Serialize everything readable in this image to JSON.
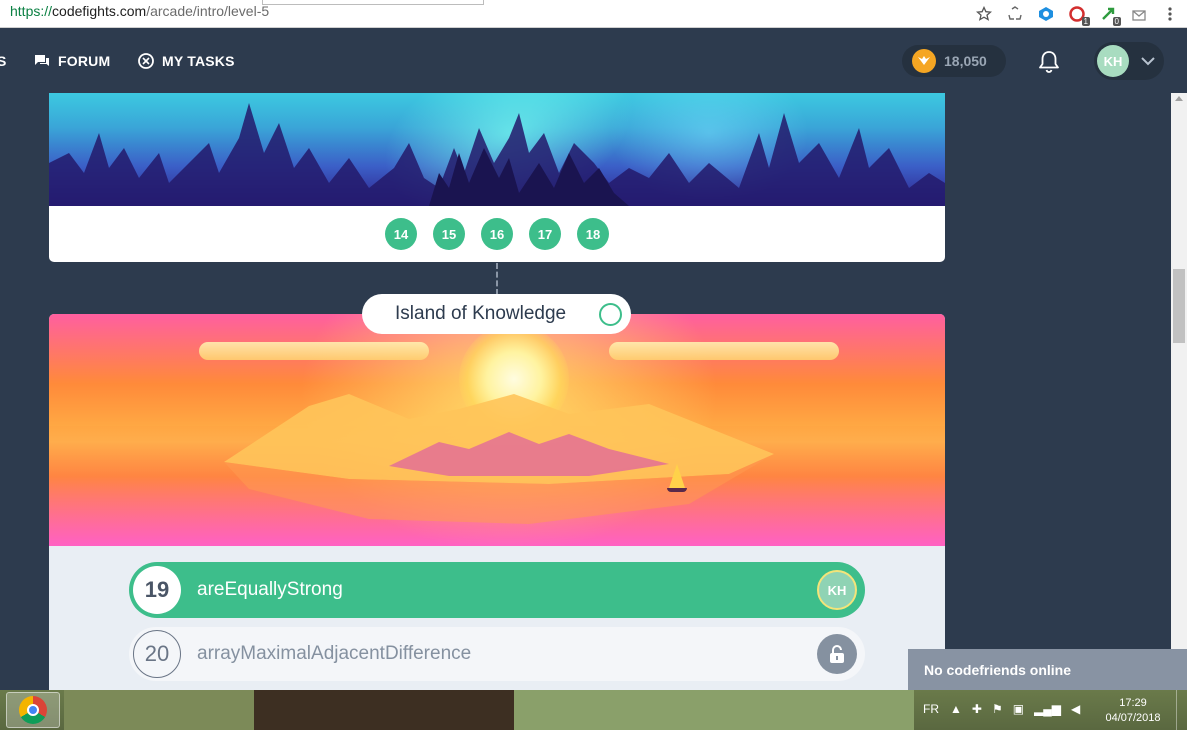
{
  "browser": {
    "url_scheme": "https://",
    "url_host": "codefights.com",
    "url_path": "/arcade/intro/level-5",
    "extension_badges": [
      "1",
      "0"
    ]
  },
  "header": {
    "nav_partial": "S",
    "forum_label": "FORUM",
    "tasks_label": "MY TASKS",
    "coins": "18,050",
    "avatar_initials": "KH"
  },
  "ocean_level": {
    "levels": [
      "14",
      "15",
      "16",
      "17",
      "18"
    ]
  },
  "island": {
    "title": "Island of Knowledge"
  },
  "tasks": [
    {
      "number": "19",
      "name": "areEquallyStrong",
      "avatar": "KH"
    },
    {
      "number": "20",
      "name": "arrayMaximalAdjacentDifference"
    }
  ],
  "friends": {
    "label": "No codefriends online"
  },
  "taskbar": {
    "lang": "FR",
    "time": "17:29",
    "date": "04/07/2018"
  }
}
